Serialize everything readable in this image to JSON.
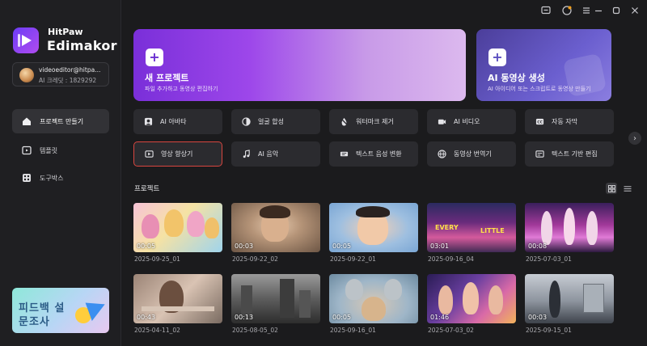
{
  "app": {
    "brand_small": "HitPaw",
    "brand_big": "Edimakor"
  },
  "account": {
    "email": "videoeditor@hitpa...",
    "credits": "AI 크레딧 : 1829292"
  },
  "nav": [
    {
      "label": "프로젝트 만들기",
      "icon": "home-icon",
      "active": true
    },
    {
      "label": "템플릿",
      "icon": "template-icon",
      "active": false
    },
    {
      "label": "도구박스",
      "icon": "toolbox-icon",
      "active": false
    }
  ],
  "promo": {
    "line1": "피드백 설",
    "line2": "문조사"
  },
  "hero": {
    "new_project": {
      "title": "새 프로젝트",
      "subtitle": "파일 추가하고 동영상 편집하기"
    },
    "ai_video": {
      "title": "AI 동영상 생성",
      "subtitle": "AI 아이디어 또는 스크립트로 동영상 만들기"
    }
  },
  "features": [
    {
      "label": "AI 아바타",
      "icon": "avatar-icon"
    },
    {
      "label": "얼굴 합성",
      "icon": "face-swap-icon"
    },
    {
      "label": "워터마크 제거",
      "icon": "watermark-remove-icon"
    },
    {
      "label": "AI 비디오",
      "icon": "ai-video-icon"
    },
    {
      "label": "자동 자막",
      "icon": "subtitle-icon"
    },
    {
      "label": "영상 향상기",
      "icon": "enhance-icon"
    },
    {
      "label": "AI 음악",
      "icon": "music-icon"
    },
    {
      "label": "텍스트 음성 변환",
      "icon": "tts-icon"
    },
    {
      "label": "동영상 번역기",
      "icon": "translate-icon"
    },
    {
      "label": "텍스트 기반 편집",
      "icon": "text-edit-icon"
    }
  ],
  "projects_title": "프로젝트",
  "projects": [
    {
      "duration": "00:05",
      "name": "2025-09-25_01"
    },
    {
      "duration": "00:03",
      "name": "2025-09-22_02"
    },
    {
      "duration": "00:05",
      "name": "2025-09-22_01"
    },
    {
      "duration": "03:01",
      "name": "2025-09-16_04"
    },
    {
      "duration": "00:08",
      "name": "2025-07-03_01"
    },
    {
      "duration": "00:43",
      "name": "2025-04-11_02"
    },
    {
      "duration": "00:13",
      "name": "2025-08-05_02"
    },
    {
      "duration": "00:05",
      "name": "2025-09-16_01"
    },
    {
      "duration": "01:46",
      "name": "2025-07-03_02"
    },
    {
      "duration": "00:03",
      "name": "2025-09-15_01"
    }
  ],
  "thumb_text": {
    "t4_a": "EVERY",
    "t4_b": "LITTLE"
  },
  "colors": {
    "accent": "#7a2fd9",
    "selected_border": "#d8463f",
    "bg": "#1b1b1d"
  }
}
